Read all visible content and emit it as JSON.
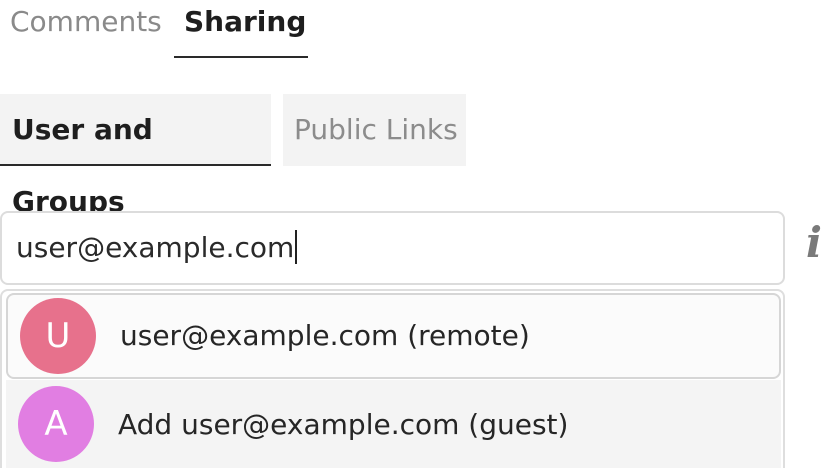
{
  "tabs": {
    "comments": "Comments",
    "sharing": "Sharing",
    "active": "sharing"
  },
  "subtabs": {
    "users_groups": "User and Groups",
    "public_links": "Public Links",
    "active": "users_groups"
  },
  "share_input": {
    "value": "user@example.com"
  },
  "info_icon": {
    "glyph": "i",
    "icon": "info-icon"
  },
  "suggestions": [
    {
      "avatar_letter": "U",
      "label": "user@example.com (remote)",
      "avatar_color": "#e7718c"
    },
    {
      "avatar_letter": "A",
      "label": "Add user@example.com (guest)",
      "avatar_color": "#e17ee2"
    }
  ],
  "colors": {
    "text_primary": "#1e1e1e",
    "text_muted": "#8a8a8a",
    "tab_background": "#f3f3f3",
    "border": "#dcdcdc"
  }
}
